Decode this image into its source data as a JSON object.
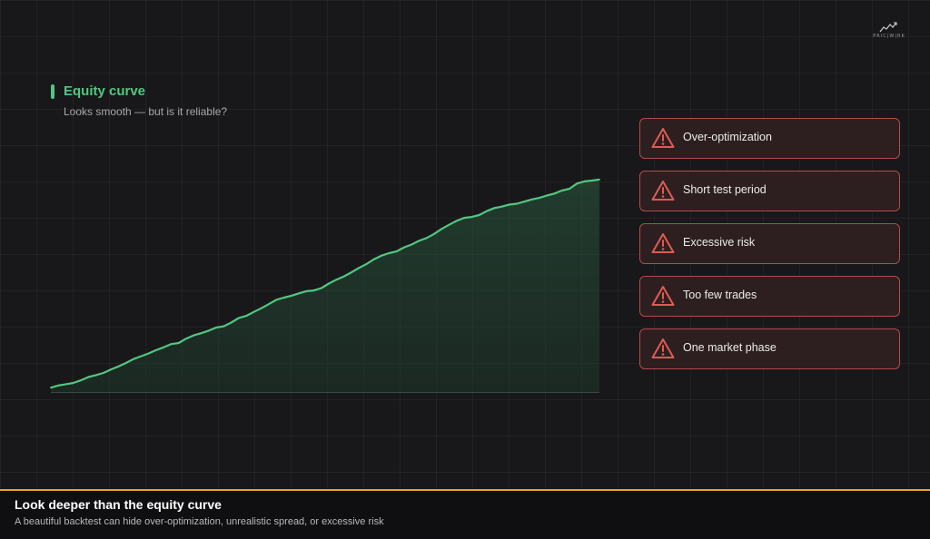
{
  "brand": {
    "logo_text": "PRIC|W|RK"
  },
  "chart_header": {
    "title": "Equity curve",
    "subtitle": "Looks smooth — but is it reliable?"
  },
  "colors": {
    "accent_green": "#52c77f",
    "warning_red": "#e05a55",
    "footer_accent": "#f0a033"
  },
  "chart_data": {
    "type": "area",
    "title": "Equity curve",
    "xlabel": "",
    "ylabel": "",
    "grid": true,
    "ylim": [
      0,
      100
    ],
    "values": [
      2,
      3,
      3.6,
      4.2,
      5.4,
      6.9,
      7.8,
      8.8,
      10.4,
      11.8,
      13.4,
      15.2,
      16.5,
      17.8,
      19.3,
      20.6,
      22.1,
      22.6,
      24.6,
      26.1,
      27.1,
      28.3,
      29.7,
      30.3,
      32,
      34.1,
      35.1,
      36.9,
      38.6,
      40.5,
      42.5,
      43.5,
      44.4,
      45.5,
      46.5,
      46.8,
      47.9,
      50,
      51.8,
      53.3,
      55.2,
      57.2,
      59,
      61.2,
      62.9,
      64,
      64.8,
      66.7,
      68,
      69.7,
      71,
      72.9,
      75.2,
      77.1,
      78.9,
      80.3,
      80.7,
      81.6,
      83.4,
      84.8,
      85.5,
      86.4,
      86.8,
      87.8,
      88.8,
      89.5,
      90.6,
      91.5,
      92.9,
      93.7,
      96.1,
      97.1,
      97.5,
      98
    ]
  },
  "risk_factors": [
    {
      "label": "Over-optimization",
      "icon": "warning-icon"
    },
    {
      "label": "Short test period",
      "icon": "warning-icon"
    },
    {
      "label": "Excessive risk",
      "icon": "warning-icon"
    },
    {
      "label": "Too few trades",
      "icon": "warning-icon"
    },
    {
      "label": "One market phase",
      "icon": "warning-icon"
    }
  ],
  "footer": {
    "title": "Look deeper than the equity curve",
    "subtitle": "A beautiful backtest can hide over-optimization, unrealistic spread, or excessive risk"
  }
}
